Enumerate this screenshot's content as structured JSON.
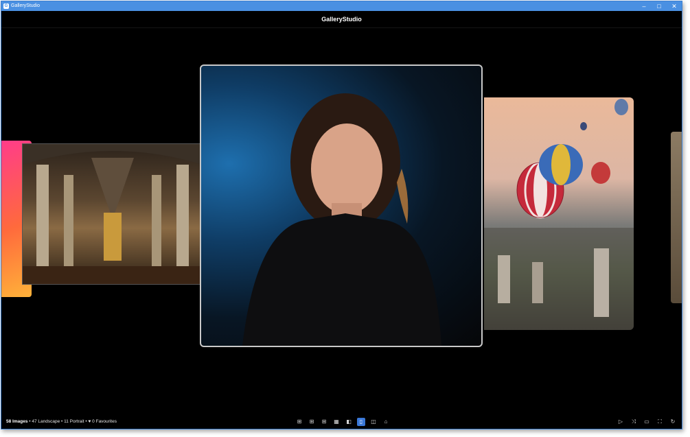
{
  "window": {
    "title": "GalleryStudio",
    "app_icon_letter": "G",
    "controls": {
      "minimize": "–",
      "maximize": "□",
      "close": "✕"
    }
  },
  "header": {
    "title": "GalleryStudio"
  },
  "gallery": {
    "cards": [
      {
        "subject": "colorful abstract flower"
      },
      {
        "subject": "gothic cathedral interior"
      },
      {
        "subject": "portrait of woman in black turtleneck"
      },
      {
        "subject": "hot air balloons over rocky valley"
      },
      {
        "subject": "partially visible image"
      }
    ]
  },
  "status": {
    "images": "58 Images",
    "landscape": "47 Landscape",
    "portrait": "11 Portrait",
    "favourites": "♥ 0 Favourites",
    "separator": "•"
  },
  "toolbar": {
    "buttons": [
      {
        "icon": "⊞",
        "name": "grid-small"
      },
      {
        "icon": "⊞",
        "name": "grid-medium"
      },
      {
        "icon": "⊞",
        "name": "grid-large"
      },
      {
        "icon": "▦",
        "name": "mosaic"
      },
      {
        "icon": "◧",
        "name": "single-view"
      },
      {
        "icon": "▯",
        "name": "carousel",
        "active": true
      },
      {
        "icon": "◫",
        "name": "compare"
      },
      {
        "icon": "⌂",
        "name": "folder"
      }
    ],
    "right_buttons": [
      {
        "icon": "▷",
        "name": "play"
      },
      {
        "icon": "⤨",
        "name": "shuffle"
      },
      {
        "icon": "▭",
        "name": "slideshow"
      },
      {
        "icon": "⛶",
        "name": "fullscreen"
      },
      {
        "icon": "↻",
        "name": "refresh"
      }
    ]
  },
  "colors": {
    "accent": "#3a78d8",
    "titlebar": "#4a90e2",
    "background": "#000000"
  }
}
